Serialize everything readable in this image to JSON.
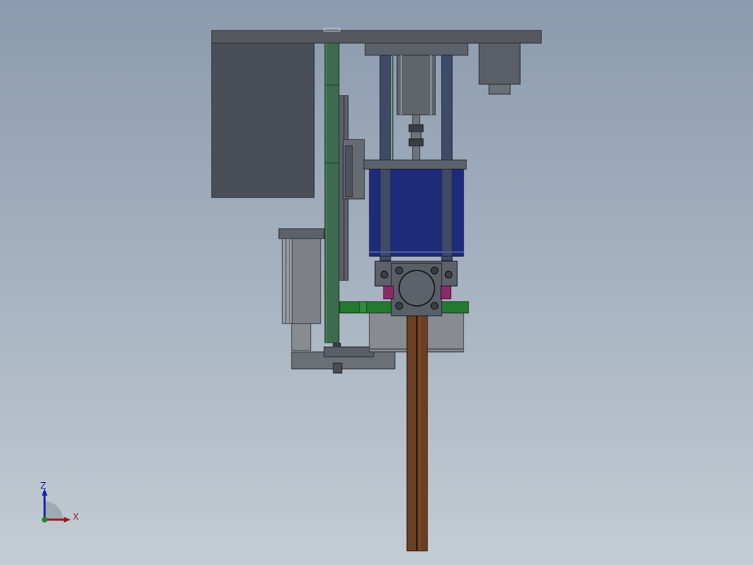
{
  "viewport": {
    "name": "cad-graphics-area",
    "background_top": "#8c9aaf",
    "background_bottom": "#c4ccd3"
  },
  "colors": {
    "frame_dark": "#55595f",
    "frame_mid": "#6b6f76",
    "housing": "#4a4e57",
    "rail_green": "#3d6b4e",
    "rod_blue": "#3e4a66",
    "block_navy": "#1c2b7a",
    "bracket_green": "#237a2e",
    "column_brown": "#6a3f22",
    "accent_magenta": "#8a2a6a",
    "motor_gray": "#888c90"
  },
  "triad": {
    "z_label": "Z",
    "x_label": "X",
    "z_color": "#1a24a8",
    "x_color": "#a01818",
    "origin_color": "#1a8a2a"
  }
}
